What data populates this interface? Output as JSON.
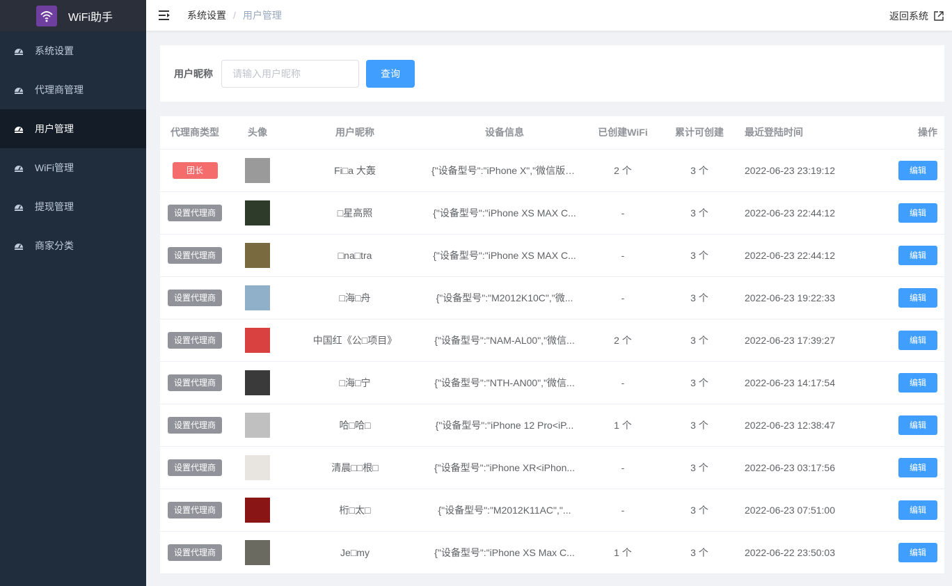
{
  "app": {
    "title": "WiFi助手"
  },
  "sidebar": {
    "items": [
      {
        "label": "系统设置",
        "active": false
      },
      {
        "label": "代理商管理",
        "active": false
      },
      {
        "label": "用户管理",
        "active": true
      },
      {
        "label": "WiFi管理",
        "active": false
      },
      {
        "label": "提现管理",
        "active": false
      },
      {
        "label": "商家分类",
        "active": false
      }
    ]
  },
  "header": {
    "breadcrumb": [
      "系统设置",
      "用户管理"
    ],
    "separator": "/",
    "return_label": "返回系统"
  },
  "search": {
    "label": "用户昵称",
    "placeholder": "请输入用户昵称",
    "value": "",
    "button_label": "查询"
  },
  "table": {
    "columns": [
      "代理商类型",
      "头像",
      "用户昵称",
      "设备信息",
      "已创建WiFi",
      "累计可创建",
      "最近登陆时间",
      "操作"
    ],
    "rows": [
      {
        "type": "团长",
        "nickname": "Fi□a 大轰",
        "device": "{\"设备型号\":\"iPhone X\",\"微信版本\"...",
        "created": "2 个",
        "total": "3 个",
        "last_login": "2022-06-23 23:19:12",
        "action": "编辑"
      },
      {
        "type": "设置代理商",
        "nickname": "□星高照",
        "device": "{\"设备型号\":\"iPhone XS MAX C...",
        "created": "-",
        "total": "3 个",
        "last_login": "2022-06-23 22:44:12",
        "action": "编辑"
      },
      {
        "type": "设置代理商",
        "nickname": "□na□tra",
        "device": "{\"设备型号\":\"iPhone XS MAX C...",
        "created": "-",
        "total": "3 个",
        "last_login": "2022-06-23 22:44:12",
        "action": "编辑"
      },
      {
        "type": "设置代理商",
        "nickname": "□海□舟",
        "device": "{\"设备型号\":\"M2012K10C\",\"微...",
        "created": "-",
        "total": "3 个",
        "last_login": "2022-06-23 19:22:33",
        "action": "编辑"
      },
      {
        "type": "设置代理商",
        "nickname": "中国红《公□项目》",
        "device": "{\"设备型号\":\"NAM-AL00\",\"微信...",
        "created": "2 个",
        "total": "3 个",
        "last_login": "2022-06-23 17:39:27",
        "action": "编辑"
      },
      {
        "type": "设置代理商",
        "nickname": "□海□宁",
        "device": "{\"设备型号\":\"NTH-AN00\",\"微信...",
        "created": "-",
        "total": "3 个",
        "last_login": "2022-06-23 14:17:54",
        "action": "编辑"
      },
      {
        "type": "设置代理商",
        "nickname": "哈□哈□",
        "device": "{\"设备型号\":\"iPhone 12 Pro<iP...",
        "created": "1 个",
        "total": "3 个",
        "last_login": "2022-06-23 12:38:47",
        "action": "编辑"
      },
      {
        "type": "设置代理商",
        "nickname": "清晨□□根□",
        "device": "{\"设备型号\":\"iPhone XR<iPhon...",
        "created": "-",
        "total": "3 个",
        "last_login": "2022-06-23 03:17:56",
        "action": "编辑"
      },
      {
        "type": "设置代理商",
        "nickname": "桁□太□",
        "device": "{\"设备型号\":\"M2012K11AC\",\"...",
        "created": "-",
        "total": "3 个",
        "last_login": "2022-06-23 07:51:00",
        "action": "编辑"
      },
      {
        "type": "设置代理商",
        "nickname": "Je□my",
        "device": "{\"设备型号\":\"iPhone XS Max C...",
        "created": "1 个",
        "total": "3 个",
        "last_login": "2022-06-22 23:50:03",
        "action": "编辑"
      }
    ]
  },
  "colors": {
    "sidebar_bg": "#1f2d3d",
    "primary": "#409eff",
    "danger": "#f56c6c",
    "info": "#909399",
    "avatars": [
      "#9a9a9a",
      "#2f3b2a",
      "#7a6a40",
      "#8fb0c8",
      "#d94040",
      "#3a3a3a",
      "#c0c0c0",
      "#e8e4e0",
      "#8a1515",
      "#6a6a60"
    ]
  }
}
